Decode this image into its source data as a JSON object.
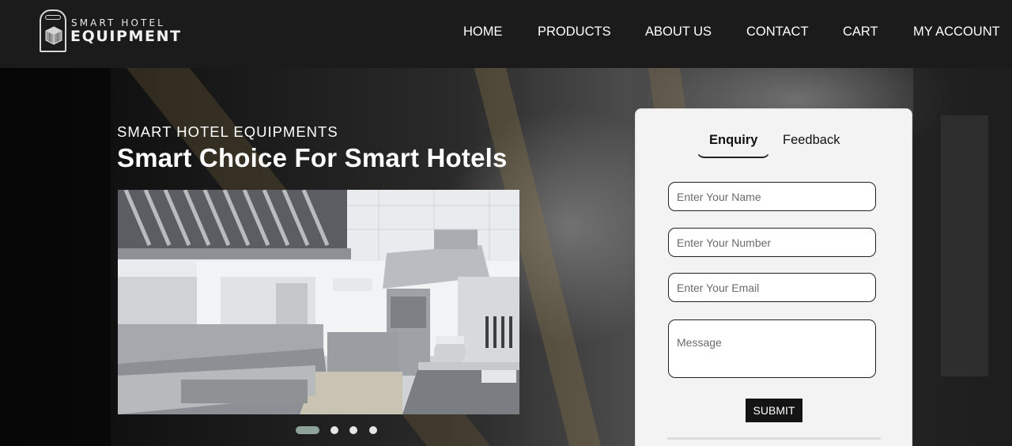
{
  "brand": {
    "line1": "SMART HOTEL",
    "line2": "EQUIPMENT"
  },
  "nav": {
    "items": [
      {
        "label": "HOME"
      },
      {
        "label": "PRODUCTS"
      },
      {
        "label": "ABOUT US"
      },
      {
        "label": "CONTACT"
      },
      {
        "label": "CART"
      },
      {
        "label": "MY ACCOUNT"
      }
    ]
  },
  "hero": {
    "subtitle": "SMART HOTEL EQUIPMENTS",
    "headline": "Smart Choice For Smart Hotels",
    "carousel": {
      "slide_count": 4,
      "active_index": 0
    }
  },
  "form": {
    "tabs": [
      {
        "label": "Enquiry",
        "active": true
      },
      {
        "label": "Feedback",
        "active": false
      }
    ],
    "name_placeholder": "Enter Your Name",
    "number_placeholder": "Enter Your Number",
    "email_placeholder": "Enter Your Email",
    "message_placeholder": "Message",
    "submit_label": "SUBMIT"
  },
  "colors": {
    "header_bg": "#1b1b1b",
    "panel_bg": "#f3f3f3",
    "active_dot": "#8fa39a",
    "button_bg": "#141414"
  }
}
